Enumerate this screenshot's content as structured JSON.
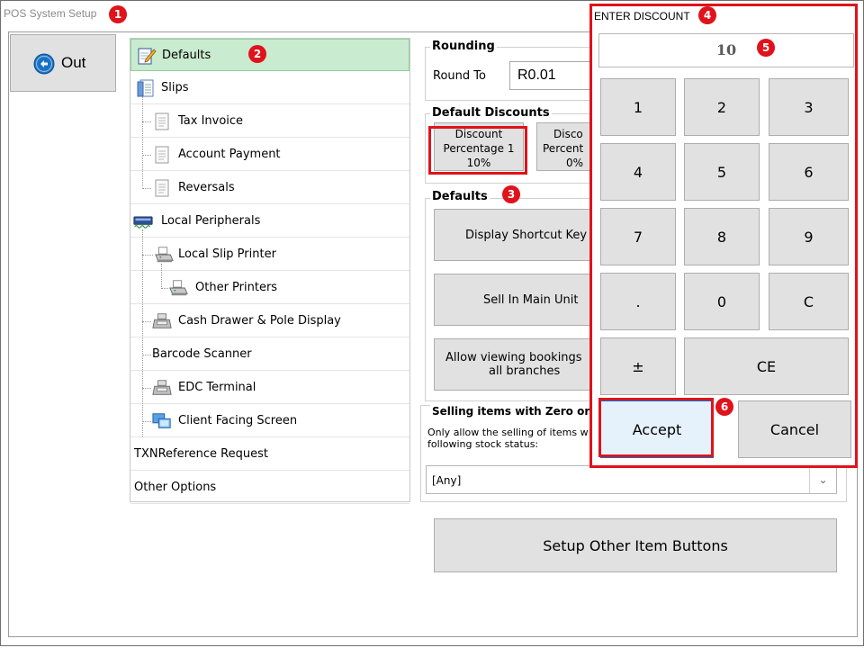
{
  "window": {
    "title": "POS System Setup"
  },
  "badges": {
    "b1": "1",
    "b2": "2",
    "b3": "3",
    "b4": "4",
    "b5": "5",
    "b6": "6"
  },
  "toolbar": {
    "out_label": "Out"
  },
  "tree": {
    "items": [
      {
        "label": "Defaults",
        "icon": "edit-document-icon",
        "selected": true
      },
      {
        "label": "Slips",
        "icon": "slips-icon"
      },
      {
        "label": "Tax Invoice",
        "icon": "document-icon"
      },
      {
        "label": "Account Payment",
        "icon": "document-icon"
      },
      {
        "label": "Reversals",
        "icon": "document-icon"
      },
      {
        "label": "Local Peripherals",
        "icon": "peripherals-icon"
      },
      {
        "label": "Local Slip Printer",
        "icon": "printer-icon"
      },
      {
        "label": "Other Printers",
        "icon": "printer-icon"
      },
      {
        "label": "Cash Drawer & Pole Display",
        "icon": "cash-register-icon"
      },
      {
        "label": "Barcode Scanner"
      },
      {
        "label": "EDC Terminal",
        "icon": "cash-register-icon"
      },
      {
        "label": "Client Facing Screen",
        "icon": "monitor-icon"
      },
      {
        "label": "TXNReference Request"
      },
      {
        "label": "Other Options"
      }
    ]
  },
  "rounding": {
    "title": "Rounding",
    "round_to_label": "Round To",
    "round_to_value": "R0.01"
  },
  "default_discounts": {
    "title": "Default Discounts",
    "cards": [
      {
        "line1": "Discount",
        "line2": "Percentage 1",
        "line3": "10%"
      },
      {
        "line1": "Disco",
        "line2": "Percent",
        "line3": "0%"
      }
    ]
  },
  "defaults": {
    "title": "Defaults",
    "buttons": [
      {
        "label": "Display Shortcut Key"
      },
      {
        "label": "Sell In Main Unit"
      },
      {
        "line1": "Allow viewing bookings",
        "line2": "all branches"
      }
    ]
  },
  "zero_stock": {
    "title": "Selling items with Zero or",
    "desc1": "Only allow the selling of items w",
    "desc2": "following stock status:",
    "select_value": "[Any]"
  },
  "setup_other_button": "Setup Other Item Buttons",
  "popup": {
    "title": "ENTER DISCOUNT",
    "display_value": "10",
    "keys": [
      "1",
      "2",
      "3",
      "4",
      "5",
      "6",
      "7",
      "8",
      "9",
      ".",
      "0",
      "C",
      "±",
      "CE"
    ],
    "accept": "Accept",
    "cancel": "Cancel"
  },
  "colors": {
    "annotation_red": "#e0121b",
    "selected_row": "#c9ebcf",
    "button_gray": "#e1e1e1"
  }
}
